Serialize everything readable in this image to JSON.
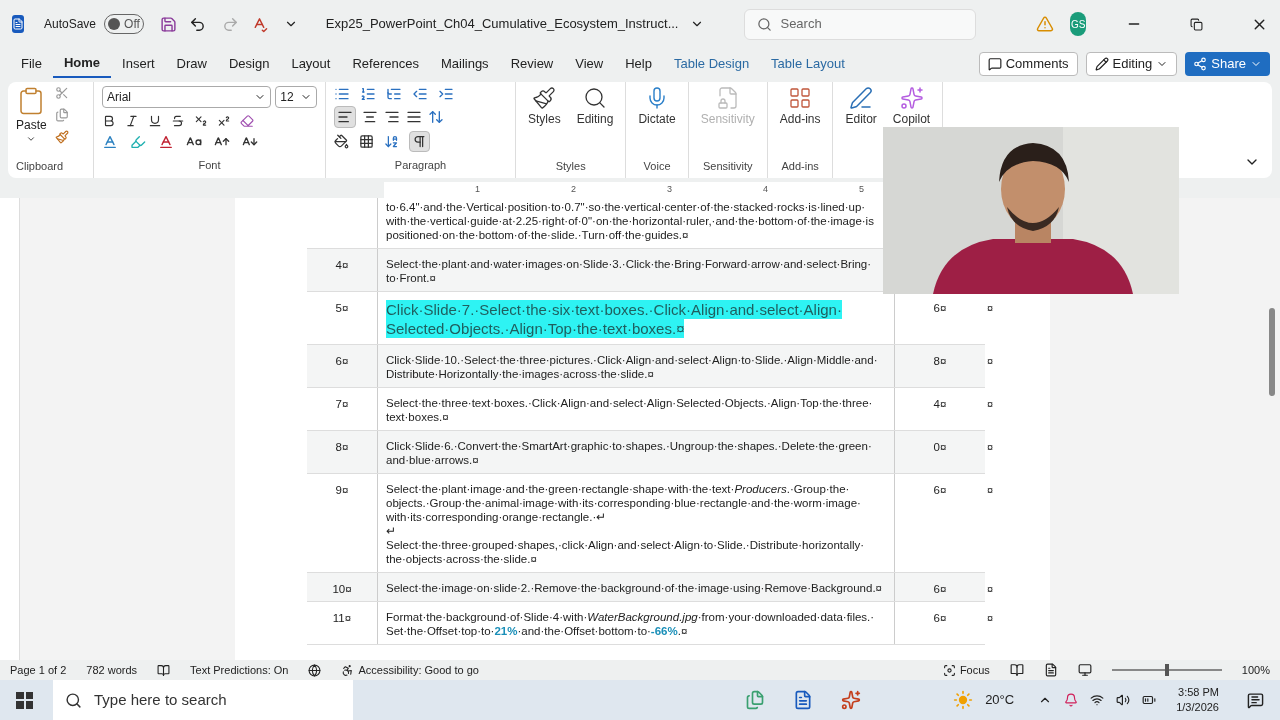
{
  "title_bar": {
    "autosave_label": "AutoSave",
    "autosave": {
      "label": "Off",
      "on": false
    },
    "document_title": "Exp25_PowerPoint_Ch04_Cumulative_Ecosystem_Instruct...",
    "search": {
      "placeholder": "Search"
    },
    "avatar": "GS"
  },
  "menu_tabs": [
    {
      "label": "File",
      "selected": false,
      "kind": "normal"
    },
    {
      "label": "Home",
      "selected": true,
      "kind": "normal"
    },
    {
      "label": "Insert",
      "selected": false,
      "kind": "normal"
    },
    {
      "label": "Draw",
      "selected": false,
      "kind": "normal"
    },
    {
      "label": "Design",
      "selected": false,
      "kind": "normal"
    },
    {
      "label": "Layout",
      "selected": false,
      "kind": "normal"
    },
    {
      "label": "References",
      "selected": false,
      "kind": "normal"
    },
    {
      "label": "Mailings",
      "selected": false,
      "kind": "normal"
    },
    {
      "label": "Review",
      "selected": false,
      "kind": "normal"
    },
    {
      "label": "View",
      "selected": false,
      "kind": "normal"
    },
    {
      "label": "Help",
      "selected": false,
      "kind": "normal"
    },
    {
      "label": "Table Design",
      "selected": false,
      "kind": "contextual"
    },
    {
      "label": "Table Layout",
      "selected": false,
      "kind": "contextual"
    }
  ],
  "actions": {
    "comments": "Comments",
    "editing": "Editing",
    "share": "Share"
  },
  "ribbon": {
    "paste": "Paste",
    "font": "Arial",
    "size": "12",
    "align_left_selected": true,
    "show_marks_selected": true,
    "big_buttons": [
      {
        "label": "Styles",
        "disabled": false,
        "kind": "styles"
      },
      {
        "label": "Editing",
        "disabled": false,
        "kind": "editing"
      },
      {
        "label": "Dictate",
        "disabled": false,
        "kind": "dictate"
      },
      {
        "label": "Sensitivity",
        "disabled": true,
        "kind": "sensitivity"
      },
      {
        "label": "Add-ins",
        "disabled": false,
        "kind": "addins"
      },
      {
        "label": "Editor",
        "disabled": false,
        "kind": "editor"
      },
      {
        "label": "Copilot",
        "disabled": false,
        "kind": "copilot"
      }
    ],
    "groups": [
      "Clipboard",
      "Font",
      "Paragraph",
      "Styles",
      "Voice",
      "Sensitivity",
      "Add-ins"
    ]
  },
  "ruler": [
    "1",
    "2",
    "3",
    "4",
    "5"
  ],
  "table": {
    "rows": [
      {
        "number": "",
        "lines": [
          "to·6.4\"·and·the·Vertical·position·to·0.7\"·so·the·vertical·center·of·the·stacked·rocks·is·lined·up·",
          "with·the·vertical·guide·at·2.25·right·of·0\"·on·the·horizontal·ruler,·and·the·bottom·of·the·image·is",
          "positioned·on·the·bottom·of·the·slide.·Turn·off·the·guides.¤"
        ],
        "highlighted": false
      },
      {
        "number": "4¤",
        "lines": [
          "Select·the·plant·and·water·images·on·Slide·3.·Click·the·Bring·Forward·arrow·and·select·Bring·",
          "to·Front.¤"
        ],
        "highlighted": false
      },
      {
        "number": "5¤",
        "lines": [
          "Click·Slide·7.·Select·the·six·text·boxes.·Click·Align·and·select·Align·",
          "Selected·Objects.·Align·Top·the·text·boxes.¤"
        ],
        "points": "6¤",
        "end_mark": "¤",
        "highlighted": true
      },
      {
        "number": "6¤",
        "lines": [
          "Click·Slide·10.·Select·the·three·pictures.·Click·Align·and·select·Align·to·Slide.·Align·Middle·and·",
          "Distribute·Horizontally·the·images·across·the·slide.¤"
        ],
        "points": "8¤",
        "end_mark": "¤",
        "highlighted": false
      },
      {
        "number": "7¤",
        "lines": [
          "Select·the·three·text·boxes.·Click·Align·and·select·Align·Selected·Objects.·Align·Top·the·three·",
          "text·boxes.¤"
        ],
        "points": "4¤",
        "end_mark": "¤",
        "highlighted": false
      },
      {
        "number": "8¤",
        "lines": [
          "Click·Slide·6.·Convert·the·SmartArt·graphic·to·shapes.·Ungroup·the·shapes.·Delete·the·green·",
          "and·blue·arrows.¤"
        ],
        "points": "0¤",
        "end_mark": "¤",
        "highlighted": false
      },
      {
        "number": "9¤",
        "lines": [
          "Select·the·plant·image·and·the·green·rectangle·shape·with·the·text·*Producers*.·Group·the·",
          "objects.·Group·the·animal·image·with·its·corresponding·blue·rectangle·and·the·worm·image·",
          "with·its·corresponding·orange·rectangle.·↵",
          "↵",
          "Select·the·three·grouped·shapes,·click·Align·and·select·Align·to·Slide.·Distribute·horizontally·",
          "the·objects·across·the·slide.¤"
        ],
        "points": "6¤",
        "end_mark": "¤",
        "highlighted": false
      },
      {
        "number": "10¤",
        "lines": [
          "Select·the·image·on·slide·2.·Remove·the·background·of·the·image·using·Remove·Background.¤"
        ],
        "points": "6¤",
        "end_mark": "¤",
        "highlighted": false
      },
      {
        "number": "11¤",
        "lines": [
          "Format·the·background·of·Slide·4·with·*WaterBackground.jpg*·from·your·downloaded·data·files.·",
          "Set·the·Offset·top·to·**21%**·and·the·Offset·bottom·to·**-66%**.¤"
        ],
        "points": "6¤",
        "end_mark": "¤",
        "highlighted": false
      }
    ]
  },
  "status_bar": {
    "page": "Page 1 of 2",
    "words": "782 words",
    "predictions": "Text Predictions: On",
    "accessibility": "Accessibility: Good to go",
    "focus": "Focus",
    "zoom": "100%",
    "zoom_slider": {
      "level": 0.5
    }
  },
  "taskbar": {
    "search": {
      "placeholder": "Type here to search"
    },
    "weather": "20°C",
    "time": "3:58 PM",
    "date": "1/3/2026"
  }
}
